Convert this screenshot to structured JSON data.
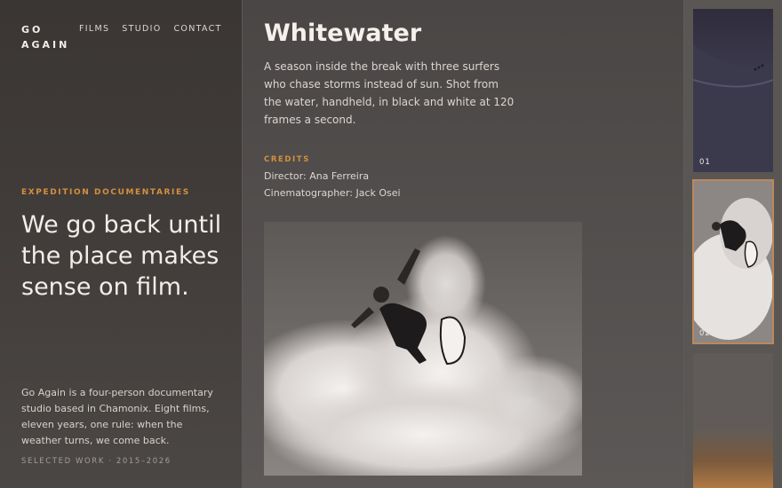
{
  "brand": {
    "logo": "GO AGAIN"
  },
  "nav": {
    "items": [
      "FILMS",
      "STUDIO",
      "CONTACT"
    ]
  },
  "hero": {
    "kicker": "EXPEDITION DOCUMENTARIES",
    "headline": "We go back until the place makes sense on film.",
    "about": "Go Again is a four-person documentary studio based in Chamonix. Eight films, eleven years, one rule: when the weather turns, we come back.",
    "footer": "SELECTED WORK · 2015–2026"
  },
  "film": {
    "title": "Whitewater",
    "description": "A season inside the break with three surfers who chase storms instead of sun. Shot from the water, handheld, in black and white at 120 frames a second.",
    "credits_label": "CREDITS",
    "credits": [
      "Director: Ana Ferreira",
      "Cinematographer: Jack Osei"
    ]
  },
  "thumbnails": [
    {
      "number": "01"
    },
    {
      "number": "02"
    },
    {
      "number": ""
    }
  ],
  "colors": {
    "accent": "#d4903e",
    "selected_outline": "#b98a5c"
  }
}
